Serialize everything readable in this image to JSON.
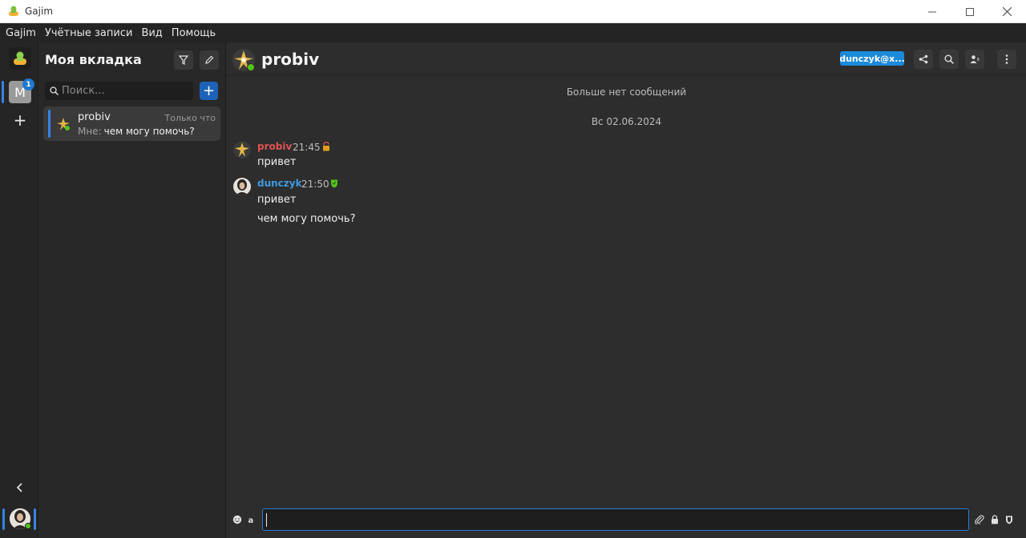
{
  "window": {
    "title": "Gajim"
  },
  "menu": {
    "items": [
      "Gajim",
      "Учётные записи",
      "Вид",
      "Помощь"
    ]
  },
  "rail": {
    "account_letter": "M",
    "unread_badge": "1",
    "add_icon": "+",
    "collapse_icon": "‹"
  },
  "chatlist": {
    "workspace_title": "Моя вкладка",
    "search_placeholder": "Поиск...",
    "new_chat_label": "+",
    "items": [
      {
        "name": "probiv",
        "time": "Только что",
        "sender_prefix": "Мне:",
        "preview": "чем могу помочь?"
      }
    ]
  },
  "chat": {
    "contact_name": "probiv",
    "account_chip": "dunczyk@x...",
    "no_more_messages": "Больше нет сообщений",
    "date_separator": "Вс 02.06.2024",
    "messages": [
      {
        "author": "probiv",
        "time": "21:45",
        "author_color": "#e05353",
        "lines": [
          "привет"
        ]
      },
      {
        "author": "dunczyk",
        "time": "21:50",
        "author_color": "#3d9be0",
        "lines": [
          "привет",
          "чем могу помочь?"
        ]
      }
    ]
  },
  "colors": {
    "accent": "#3584e4",
    "online": "#52c41a",
    "chip": "#1b8adb"
  },
  "input": {
    "value": "",
    "placeholder": ""
  }
}
